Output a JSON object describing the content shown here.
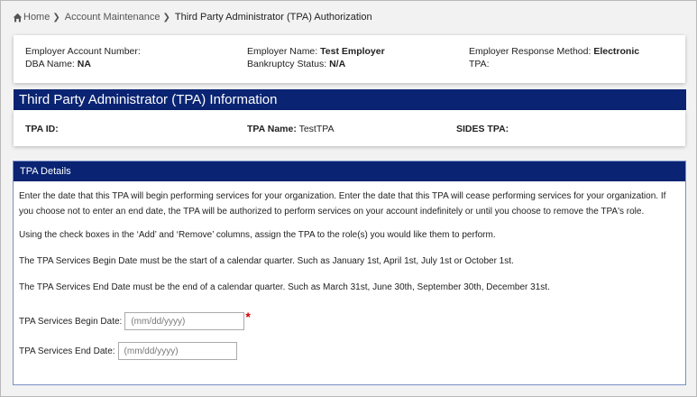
{
  "breadcrumb": {
    "home": "Home",
    "account_maintenance": "Account Maintenance",
    "current": "Third Party Administrator (TPA) Authorization"
  },
  "employer": {
    "account_number_label": "Employer Account Number:",
    "account_number_value": "",
    "name_label": "Employer Name:",
    "name_value": "Test Employer",
    "response_method_label": "Employer Response Method:",
    "response_method_value": "Electronic",
    "dba_label": "DBA Name:",
    "dba_value": "NA",
    "bankruptcy_label": "Bankruptcy Status:",
    "bankruptcy_value": "N/A",
    "tpa_label": "TPA:",
    "tpa_value": ""
  },
  "tpa_info": {
    "header": "Third Party Administrator (TPA) Information",
    "id_label": "TPA ID:",
    "id_value": "",
    "name_label": "TPA Name:",
    "name_value": "TestTPA",
    "sides_label": "SIDES TPA:",
    "sides_value": ""
  },
  "tpa_details": {
    "header": "TPA Details",
    "para1": "Enter the date that this TPA will begin performing services for your organization. Enter the date that this TPA will cease performing services for your organization. If you choose not to enter an end date, the TPA will be authorized to perform services on your account indefinitely or until you choose to remove the TPA's role.",
    "para2": "Using the check boxes in the ‘Add’ and ‘Remove’ columns, assign the TPA to the role(s) you would like them to perform.",
    "para3": "The TPA Services Begin Date must be the start of a calendar quarter. Such as January 1st, April 1st, July 1st or October 1st.",
    "para4": "The TPA Services End Date must be the end of a calendar quarter. Such as March 31st, June 30th, September 30th, December 31st.",
    "begin_label": "TPA Services Begin Date:",
    "begin_placeholder": "(mm/dd/yyyy)",
    "begin_value": "",
    "required_marker": "*",
    "end_label": "TPA Services End Date:",
    "end_placeholder": "(mm/dd/yyyy)",
    "end_value": ""
  },
  "colors": {
    "header_bg": "#0a2473",
    "required": "#d40000"
  },
  "icons": {
    "home": "home-icon",
    "separator": "chevron-right-icon"
  }
}
